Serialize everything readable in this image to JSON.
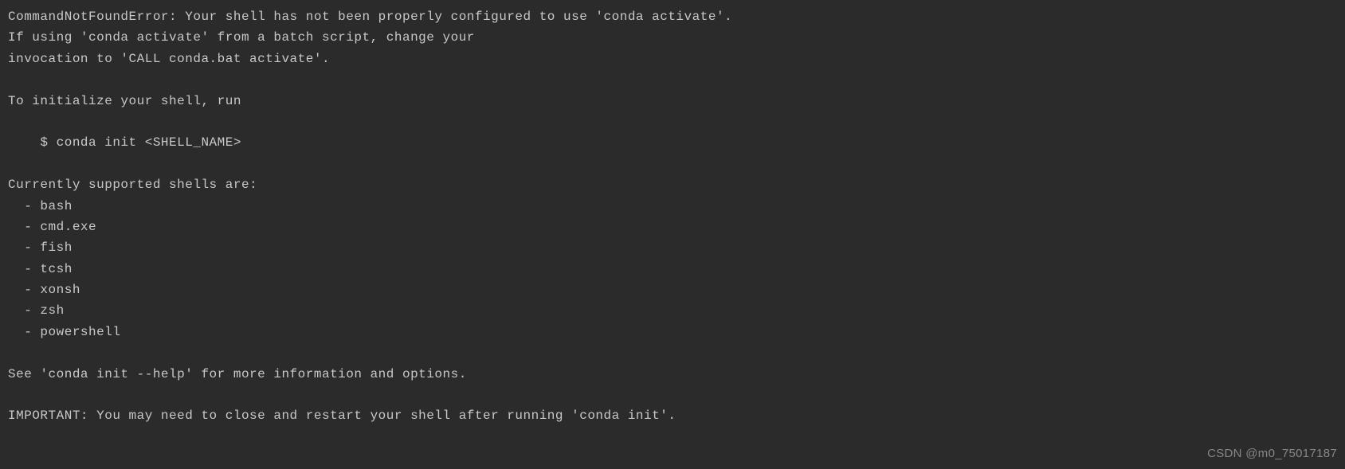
{
  "terminal": {
    "lines": [
      "CommandNotFoundError: Your shell has not been properly configured to use 'conda activate'.",
      "If using 'conda activate' from a batch script, change your",
      "invocation to 'CALL conda.bat activate'.",
      "",
      "To initialize your shell, run",
      "",
      "    $ conda init <SHELL_NAME>",
      "",
      "Currently supported shells are:",
      "  - bash",
      "  - cmd.exe",
      "  - fish",
      "  - tcsh",
      "  - xonsh",
      "  - zsh",
      "  - powershell",
      "",
      "See 'conda init --help' for more information and options.",
      "",
      "IMPORTANT: You may need to close and restart your shell after running 'conda init'."
    ]
  },
  "watermark": {
    "text": "CSDN @m0_75017187"
  }
}
